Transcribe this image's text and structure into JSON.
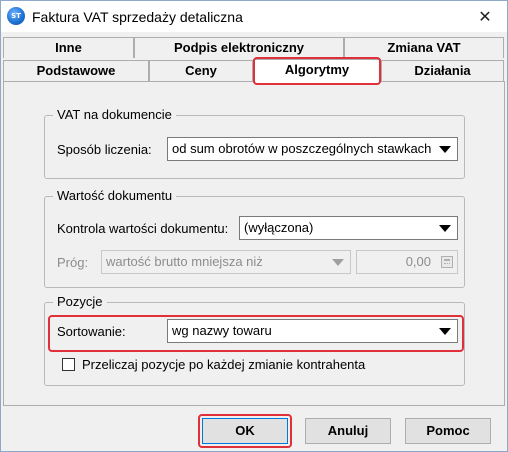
{
  "window": {
    "title": "Faktura VAT sprzedaży detaliczna",
    "icon_text": "ST",
    "close_glyph": "✕"
  },
  "tabs": {
    "row1": [
      "Inne",
      "Podpis elektroniczny",
      "Zmiana VAT"
    ],
    "row2": [
      "Podstawowe",
      "Ceny",
      "Algorytmy",
      "Działania"
    ],
    "active": "Algorytmy"
  },
  "vat_group": {
    "title": "VAT na dokumencie",
    "method_label": "Sposób liczenia:",
    "method_value": "od sum obrotów w poszczególnych stawkach"
  },
  "value_group": {
    "title": "Wartość dokumentu",
    "control_label": "Kontrola wartości dokumentu:",
    "control_value": "(wyłączona)",
    "threshold_label": "Próg:",
    "threshold_condition": "wartość brutto mniejsza niż",
    "threshold_amount": "0,00"
  },
  "positions_group": {
    "title": "Pozycje",
    "sort_label": "Sortowanie:",
    "sort_value": "wg nazwy towaru",
    "recalc_label": "Przeliczaj pozycje po każdej zmianie kontrahenta",
    "recalc_checked": false
  },
  "buttons": {
    "ok": "OK",
    "cancel": "Anuluj",
    "help": "Pomoc"
  },
  "colors": {
    "highlight": "#e0303a",
    "accent": "#0078d7"
  }
}
